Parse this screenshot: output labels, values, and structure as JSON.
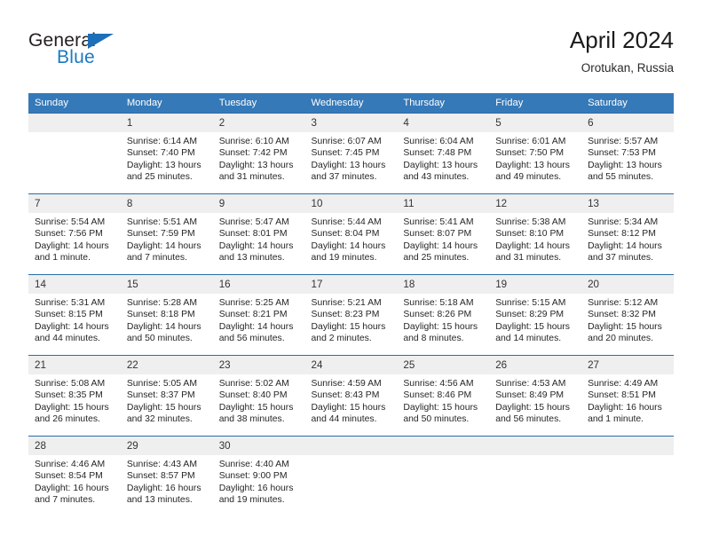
{
  "brand": {
    "word_one": "General",
    "word_two": "Blue",
    "triangle_icon": "blue-triangle-icon",
    "accent_color": "#1a7ac4"
  },
  "header": {
    "title": "April 2024",
    "subtitle": "Orotukan, Russia",
    "header_bg": "#3579b8",
    "row_divider": "#2c6ca8",
    "daynum_bg": "#efefef"
  },
  "weekday_headers": [
    "Sunday",
    "Monday",
    "Tuesday",
    "Wednesday",
    "Thursday",
    "Friday",
    "Saturday"
  ],
  "weeks": [
    [
      {
        "day": "",
        "sunrise": "",
        "sunset": "",
        "daylight": "",
        "blank": true
      },
      {
        "day": "1",
        "sunrise": "Sunrise: 6:14 AM",
        "sunset": "Sunset: 7:40 PM",
        "daylight": "Daylight: 13 hours and 25 minutes."
      },
      {
        "day": "2",
        "sunrise": "Sunrise: 6:10 AM",
        "sunset": "Sunset: 7:42 PM",
        "daylight": "Daylight: 13 hours and 31 minutes."
      },
      {
        "day": "3",
        "sunrise": "Sunrise: 6:07 AM",
        "sunset": "Sunset: 7:45 PM",
        "daylight": "Daylight: 13 hours and 37 minutes."
      },
      {
        "day": "4",
        "sunrise": "Sunrise: 6:04 AM",
        "sunset": "Sunset: 7:48 PM",
        "daylight": "Daylight: 13 hours and 43 minutes."
      },
      {
        "day": "5",
        "sunrise": "Sunrise: 6:01 AM",
        "sunset": "Sunset: 7:50 PM",
        "daylight": "Daylight: 13 hours and 49 minutes."
      },
      {
        "day": "6",
        "sunrise": "Sunrise: 5:57 AM",
        "sunset": "Sunset: 7:53 PM",
        "daylight": "Daylight: 13 hours and 55 minutes."
      }
    ],
    [
      {
        "day": "7",
        "sunrise": "Sunrise: 5:54 AM",
        "sunset": "Sunset: 7:56 PM",
        "daylight": "Daylight: 14 hours and 1 minute."
      },
      {
        "day": "8",
        "sunrise": "Sunrise: 5:51 AM",
        "sunset": "Sunset: 7:59 PM",
        "daylight": "Daylight: 14 hours and 7 minutes."
      },
      {
        "day": "9",
        "sunrise": "Sunrise: 5:47 AM",
        "sunset": "Sunset: 8:01 PM",
        "daylight": "Daylight: 14 hours and 13 minutes."
      },
      {
        "day": "10",
        "sunrise": "Sunrise: 5:44 AM",
        "sunset": "Sunset: 8:04 PM",
        "daylight": "Daylight: 14 hours and 19 minutes."
      },
      {
        "day": "11",
        "sunrise": "Sunrise: 5:41 AM",
        "sunset": "Sunset: 8:07 PM",
        "daylight": "Daylight: 14 hours and 25 minutes."
      },
      {
        "day": "12",
        "sunrise": "Sunrise: 5:38 AM",
        "sunset": "Sunset: 8:10 PM",
        "daylight": "Daylight: 14 hours and 31 minutes."
      },
      {
        "day": "13",
        "sunrise": "Sunrise: 5:34 AM",
        "sunset": "Sunset: 8:12 PM",
        "daylight": "Daylight: 14 hours and 37 minutes."
      }
    ],
    [
      {
        "day": "14",
        "sunrise": "Sunrise: 5:31 AM",
        "sunset": "Sunset: 8:15 PM",
        "daylight": "Daylight: 14 hours and 44 minutes."
      },
      {
        "day": "15",
        "sunrise": "Sunrise: 5:28 AM",
        "sunset": "Sunset: 8:18 PM",
        "daylight": "Daylight: 14 hours and 50 minutes."
      },
      {
        "day": "16",
        "sunrise": "Sunrise: 5:25 AM",
        "sunset": "Sunset: 8:21 PM",
        "daylight": "Daylight: 14 hours and 56 minutes."
      },
      {
        "day": "17",
        "sunrise": "Sunrise: 5:21 AM",
        "sunset": "Sunset: 8:23 PM",
        "daylight": "Daylight: 15 hours and 2 minutes."
      },
      {
        "day": "18",
        "sunrise": "Sunrise: 5:18 AM",
        "sunset": "Sunset: 8:26 PM",
        "daylight": "Daylight: 15 hours and 8 minutes."
      },
      {
        "day": "19",
        "sunrise": "Sunrise: 5:15 AM",
        "sunset": "Sunset: 8:29 PM",
        "daylight": "Daylight: 15 hours and 14 minutes."
      },
      {
        "day": "20",
        "sunrise": "Sunrise: 5:12 AM",
        "sunset": "Sunset: 8:32 PM",
        "daylight": "Daylight: 15 hours and 20 minutes."
      }
    ],
    [
      {
        "day": "21",
        "sunrise": "Sunrise: 5:08 AM",
        "sunset": "Sunset: 8:35 PM",
        "daylight": "Daylight: 15 hours and 26 minutes."
      },
      {
        "day": "22",
        "sunrise": "Sunrise: 5:05 AM",
        "sunset": "Sunset: 8:37 PM",
        "daylight": "Daylight: 15 hours and 32 minutes."
      },
      {
        "day": "23",
        "sunrise": "Sunrise: 5:02 AM",
        "sunset": "Sunset: 8:40 PM",
        "daylight": "Daylight: 15 hours and 38 minutes."
      },
      {
        "day": "24",
        "sunrise": "Sunrise: 4:59 AM",
        "sunset": "Sunset: 8:43 PM",
        "daylight": "Daylight: 15 hours and 44 minutes."
      },
      {
        "day": "25",
        "sunrise": "Sunrise: 4:56 AM",
        "sunset": "Sunset: 8:46 PM",
        "daylight": "Daylight: 15 hours and 50 minutes."
      },
      {
        "day": "26",
        "sunrise": "Sunrise: 4:53 AM",
        "sunset": "Sunset: 8:49 PM",
        "daylight": "Daylight: 15 hours and 56 minutes."
      },
      {
        "day": "27",
        "sunrise": "Sunrise: 4:49 AM",
        "sunset": "Sunset: 8:51 PM",
        "daylight": "Daylight: 16 hours and 1 minute."
      }
    ],
    [
      {
        "day": "28",
        "sunrise": "Sunrise: 4:46 AM",
        "sunset": "Sunset: 8:54 PM",
        "daylight": "Daylight: 16 hours and 7 minutes."
      },
      {
        "day": "29",
        "sunrise": "Sunrise: 4:43 AM",
        "sunset": "Sunset: 8:57 PM",
        "daylight": "Daylight: 16 hours and 13 minutes."
      },
      {
        "day": "30",
        "sunrise": "Sunrise: 4:40 AM",
        "sunset": "Sunset: 9:00 PM",
        "daylight": "Daylight: 16 hours and 19 minutes."
      },
      {
        "day": "",
        "sunrise": "",
        "sunset": "",
        "daylight": "",
        "blank": true
      },
      {
        "day": "",
        "sunrise": "",
        "sunset": "",
        "daylight": "",
        "blank": true
      },
      {
        "day": "",
        "sunrise": "",
        "sunset": "",
        "daylight": "",
        "blank": true
      },
      {
        "day": "",
        "sunrise": "",
        "sunset": "",
        "daylight": "",
        "blank": true
      }
    ]
  ]
}
